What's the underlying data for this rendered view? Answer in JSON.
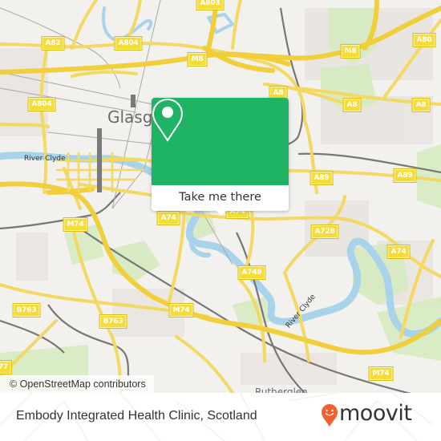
{
  "map": {
    "place_labels": [
      {
        "text": "Glasgow",
        "visible_text": "Glasgo"
      },
      {
        "text": "Rutherglen",
        "visible_text": "Rutherglen"
      }
    ],
    "river_labels": [
      "River Clyde",
      "River Clyde"
    ],
    "road_shields": [
      {
        "id": "a803",
        "label": "A803"
      },
      {
        "id": "a82",
        "label": "A82"
      },
      {
        "id": "a804-n",
        "label": "A804"
      },
      {
        "id": "m8-w",
        "label": "M8"
      },
      {
        "id": "m8-e",
        "label": "M8"
      },
      {
        "id": "a80",
        "label": "A80"
      },
      {
        "id": "a804-w",
        "label": "A804"
      },
      {
        "id": "a8-1",
        "label": "A8"
      },
      {
        "id": "a8-2",
        "label": "A8"
      },
      {
        "id": "a8-3",
        "label": "A8"
      },
      {
        "id": "a89-1",
        "label": "A89"
      },
      {
        "id": "a89-2",
        "label": "A89"
      },
      {
        "id": "a74-w",
        "label": "A74"
      },
      {
        "id": "a74-c",
        "label": "A74"
      },
      {
        "id": "a728",
        "label": "A728"
      },
      {
        "id": "a74-e",
        "label": "A74"
      },
      {
        "id": "m74-w",
        "label": "M74"
      },
      {
        "id": "a749",
        "label": "A749"
      },
      {
        "id": "m74-c",
        "label": "M74"
      },
      {
        "id": "b763-w",
        "label": "B763"
      },
      {
        "id": "b763-c",
        "label": "B763"
      },
      {
        "id": "m74-e",
        "label": "M74"
      },
      {
        "id": "a77",
        "label": "77"
      }
    ],
    "attribution": "© OpenStreetMap contributors"
  },
  "popup": {
    "icon": "location-pin-icon",
    "cta_label": "Take me there",
    "accent_color": "#1eb463"
  },
  "footer": {
    "place_name": "Embody Integrated Health Clinic, Scotland",
    "brand": "moovit",
    "brand_icon": "moovit-smiley-pin-icon",
    "brand_color": "#f0612d"
  }
}
